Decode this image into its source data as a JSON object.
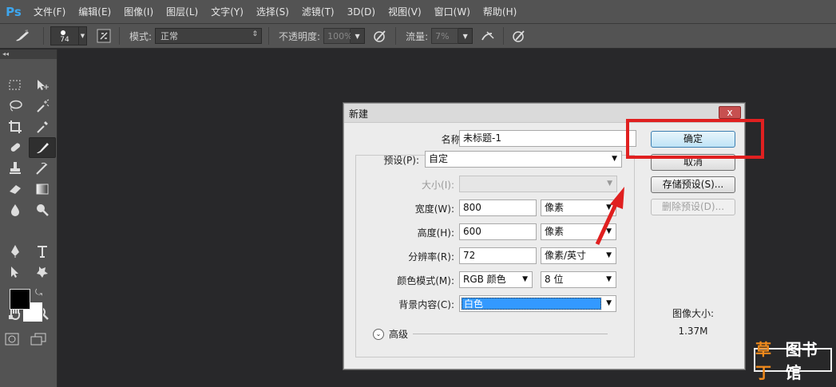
{
  "app": {
    "logo": "Ps"
  },
  "menu": [
    "文件(F)",
    "编辑(E)",
    "图像(I)",
    "图层(L)",
    "文字(Y)",
    "选择(S)",
    "滤镜(T)",
    "3D(D)",
    "视图(V)",
    "窗口(W)",
    "帮助(H)"
  ],
  "options_bar": {
    "brush_size": "74",
    "mode_label": "模式:",
    "mode_value": "正常",
    "opacity_label": "不透明度:",
    "opacity_value": "100%",
    "flow_label": "流量:",
    "flow_value": "7%"
  },
  "toolbox": {
    "tools": [
      "marquee-tool",
      "move-tool",
      "lasso-tool",
      "magic-wand-tool",
      "crop-tool",
      "eyedropper-tool",
      "healing-brush-tool",
      "brush-tool",
      "clone-stamp-tool",
      "history-brush-tool",
      "eraser-tool",
      "gradient-tool",
      "blur-tool",
      "dodge-tool",
      "pen-tool",
      "type-tool",
      "path-selection-tool",
      "custom-shape-tool",
      "hand-tool",
      "zoom-tool"
    ],
    "active_tool": "brush-tool",
    "foreground_color": "#000000",
    "background_color": "#ffffff"
  },
  "dialog": {
    "title": "新建",
    "name_label": "名称(N):",
    "name_value": "未标题-1",
    "preset_label": "预设(P):",
    "preset_value": "自定",
    "size_label": "大小(I):",
    "size_value": "",
    "width_label": "宽度(W):",
    "width_value": "800",
    "width_unit": "像素",
    "height_label": "高度(H):",
    "height_value": "600",
    "height_unit": "像素",
    "resolution_label": "分辨率(R):",
    "resolution_value": "72",
    "resolution_unit": "像素/英寸",
    "color_mode_label": "颜色模式(M):",
    "color_mode_value": "RGB 颜色",
    "bit_depth_value": "8 位",
    "background_label": "背景内容(C):",
    "background_value": "白色",
    "advanced_label": "高级",
    "image_size_title": "图像大小:",
    "image_size_value": "1.37M",
    "ok_label": "确定",
    "cancel_label": "取消",
    "save_preset_label": "存储预设(S)...",
    "delete_preset_label": "删除预设(D)...",
    "close_glyph": "x"
  },
  "watermark": {
    "part1": "草丁",
    "part2": "图书馆"
  },
  "colors": {
    "annotation": "#e02020",
    "ui_dark": "#535353",
    "canvas": "#28282a"
  }
}
